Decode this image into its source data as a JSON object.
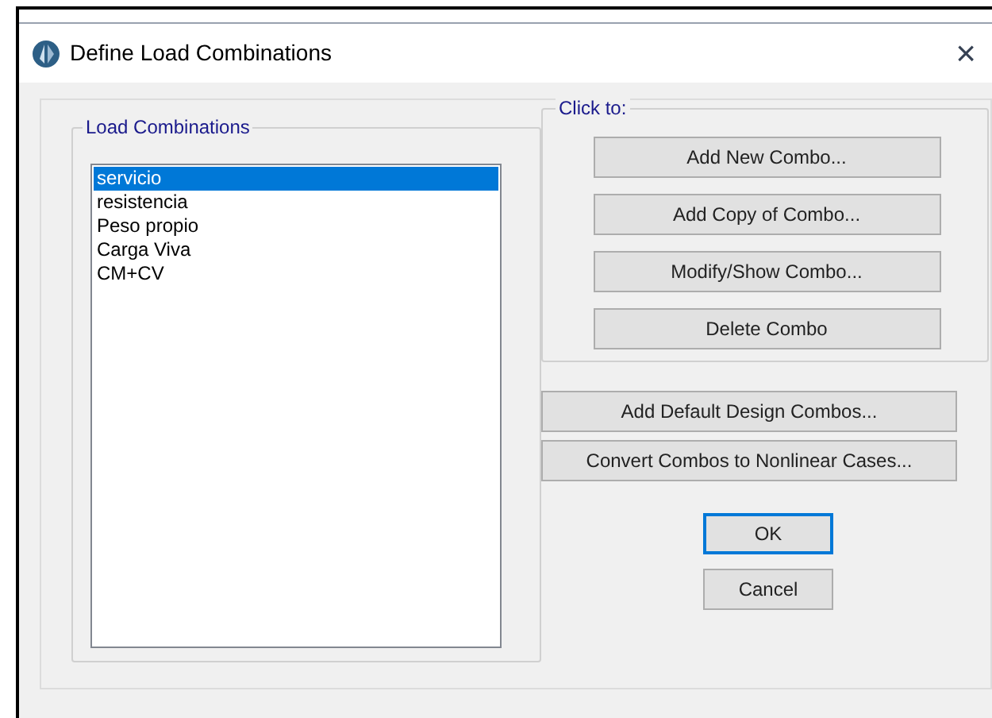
{
  "window": {
    "title": "Define Load Combinations",
    "close": "×"
  },
  "combinations": {
    "label": "Load Combinations",
    "items": [
      {
        "label": "servicio",
        "selected": true
      },
      {
        "label": "resistencia",
        "selected": false
      },
      {
        "label": "Peso propio",
        "selected": false
      },
      {
        "label": "Carga Viva",
        "selected": false
      },
      {
        "label": "CM+CV",
        "selected": false
      }
    ]
  },
  "click_to": {
    "label": "Click to:",
    "buttons": [
      "Add New Combo...",
      "Add Copy of Combo...",
      "Modify/Show Combo...",
      "Delete Combo"
    ]
  },
  "extra_buttons": [
    "Add Default Design Combos...",
    "Convert Combos to Nonlinear Cases..."
  ],
  "dialog_buttons": [
    {
      "label": "OK",
      "default": true
    },
    {
      "label": "Cancel",
      "default": false
    }
  ]
}
